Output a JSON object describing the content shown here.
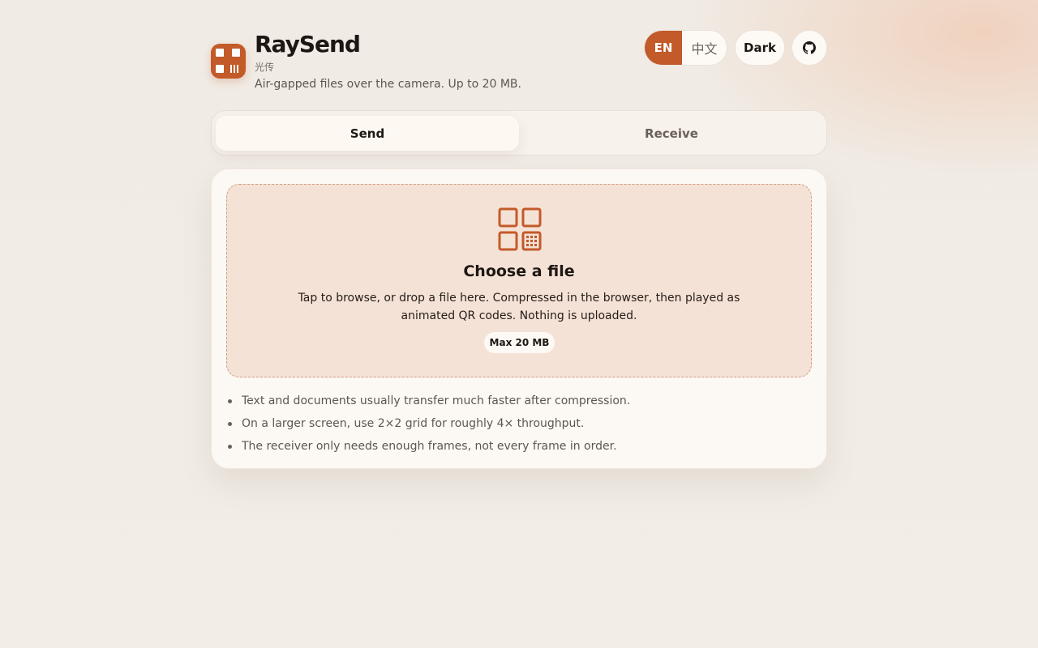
{
  "app": {
    "name": "RaySend",
    "name_cn": "光传",
    "tagline": "Air-gapped files over the camera. Up to 20 MB."
  },
  "header": {
    "lang_en": "EN",
    "lang_zh": "中文",
    "theme_label": "Dark",
    "github_icon": "github-icon"
  },
  "tabs": [
    {
      "label": "Send",
      "active": true
    },
    {
      "label": "Receive",
      "active": false
    }
  ],
  "dropzone": {
    "icon": "qr-grid-icon",
    "title": "Choose a file",
    "description": "Tap to browse, or drop a file here. Compressed in the browser, then played as animated QR codes. Nothing is uploaded.",
    "badge": "Max 20 MB"
  },
  "tips": [
    "Text and documents usually transfer much faster after compression.",
    "On a larger screen, use 2×2 grid for roughly 4× throughput.",
    "The receiver only needs enough frames, not every frame in order."
  ],
  "colors": {
    "accent": "#c25a2a",
    "dropzone_bg": "#f5e2d6",
    "background": "#f1ece6"
  }
}
